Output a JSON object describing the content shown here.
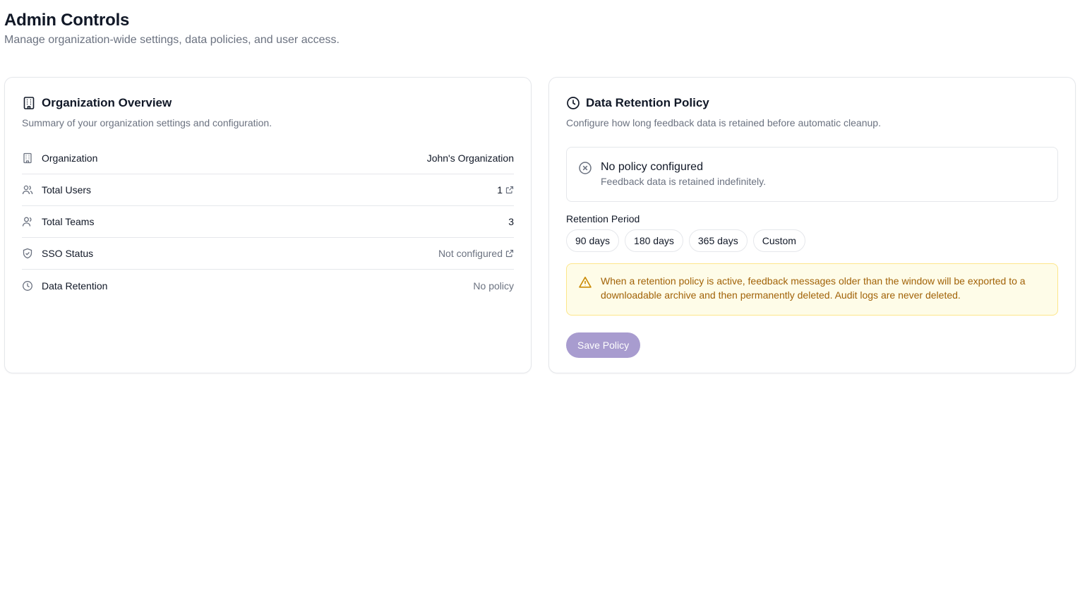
{
  "header": {
    "title": "Admin Controls",
    "subtitle": "Manage organization-wide settings, data policies, and user access."
  },
  "overview": {
    "title": "Organization Overview",
    "description": "Summary of your organization settings and configuration.",
    "rows": [
      {
        "label": "Organization",
        "value": "John's Organization",
        "icon": "building-icon"
      },
      {
        "label": "Total Users",
        "value": "1",
        "icon": "users-icon",
        "link": true
      },
      {
        "label": "Total Teams",
        "value": "3",
        "icon": "team-icon"
      },
      {
        "label": "SSO Status",
        "value": "Not configured",
        "icon": "shield-icon",
        "link": true
      },
      {
        "label": "Data Retention",
        "value": "No policy",
        "icon": "clock-icon"
      }
    ]
  },
  "retention": {
    "title": "Data Retention Policy",
    "description": "Configure how long feedback data is retained before automatic cleanup.",
    "status_title": "No policy configured",
    "status_sub": "Feedback data is retained indefinitely.",
    "period_label": "Retention Period",
    "options": [
      "90 days",
      "180 days",
      "365 days",
      "Custom"
    ],
    "warning": "When a retention policy is active, feedback messages older than the window will be exported to a downloadable archive and then permanently deleted. Audit logs are never deleted.",
    "save_label": "Save Policy"
  },
  "colors": {
    "accent": "#a89ccf",
    "warning_bg": "#fefce8",
    "warning_text": "#a16207"
  }
}
